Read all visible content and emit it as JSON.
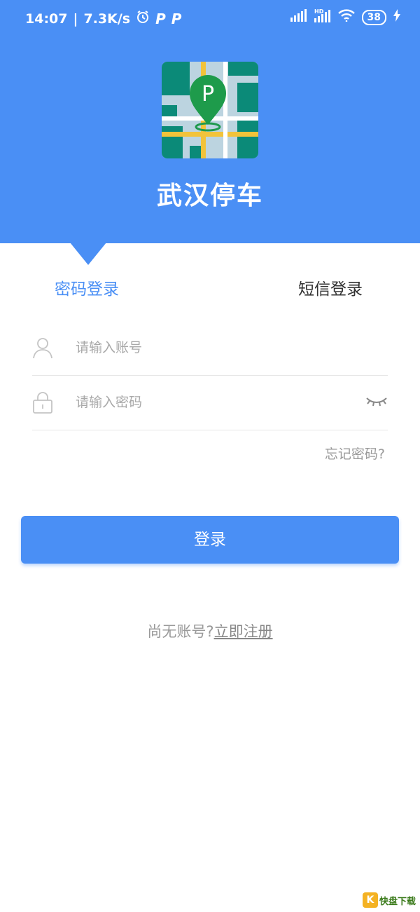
{
  "status_bar": {
    "time": "14:07",
    "network_speed": "7.3K/s",
    "battery": "38"
  },
  "header": {
    "app_name": "武汉停车",
    "accent_color": "#4a8ff5"
  },
  "tabs": [
    {
      "label": "密码登录",
      "active": true
    },
    {
      "label": "短信登录",
      "active": false
    }
  ],
  "form": {
    "account_placeholder": "请输入账号",
    "password_placeholder": "请输入密码",
    "forgot_label": "忘记密码?"
  },
  "login_button": {
    "label": "登录"
  },
  "register": {
    "prompt": "尚无账号?",
    "link_label": "立即注册"
  },
  "watermark": {
    "text": "快盘下载",
    "badge": "K"
  }
}
